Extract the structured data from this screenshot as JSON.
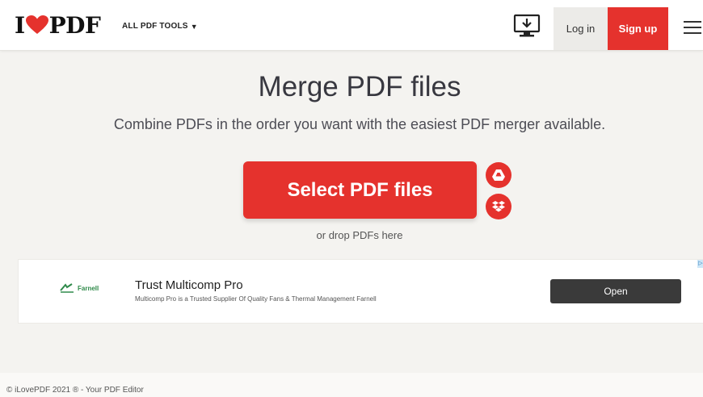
{
  "header": {
    "logo_left": "I",
    "logo_right": "PDF",
    "tools_menu_label": "ALL PDF TOOLS",
    "login_label": "Log in",
    "signup_label": "Sign up",
    "icons": [
      "heart-icon",
      "desktop-download-icon",
      "hamburger-menu-icon"
    ]
  },
  "hero": {
    "title": "Merge PDF files",
    "subtitle": "Combine PDFs in the order you want with the easiest PDF merger available.",
    "select_button_label": "Select PDF files",
    "drop_hint": "or drop PDFs here",
    "upload_sources": [
      "google-drive-icon",
      "dropbox-icon"
    ]
  },
  "ad": {
    "brand": "Farnell",
    "title": "Trust Multicomp Pro",
    "description": "Multicomp Pro is a Trusted Supplier Of Quality Fans & Thermal Management Farnell",
    "button_label": "Open"
  },
  "footer": {
    "copyright": "© iLovePDF 2021 ® - Your PDF Editor"
  },
  "colors": {
    "accent": "#e5322d",
    "background": "#f4f3f0",
    "ad_button": "#3a3a3a"
  }
}
